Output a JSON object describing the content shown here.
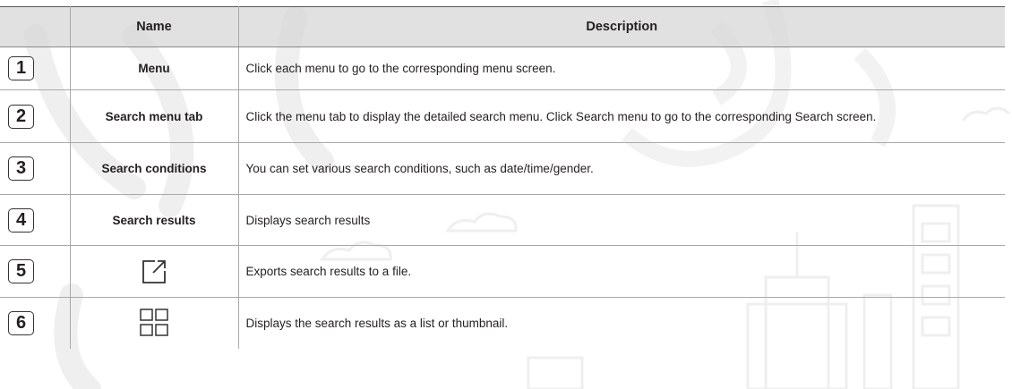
{
  "header": {
    "name_col": "Name",
    "desc_col": "Description"
  },
  "rows": [
    {
      "num": "1",
      "name": "Menu",
      "description": "Click each menu to go to the corresponding menu screen."
    },
    {
      "num": "2",
      "name": "Search menu tab",
      "description": "Click the menu tab to display the detailed search menu. Click Search menu to go to the corresponding Search screen."
    },
    {
      "num": "3",
      "name": "Search conditions",
      "description": "You can set various search conditions, such as date/time/gender."
    },
    {
      "num": "4",
      "name": "Search results",
      "description": "Displays search results"
    },
    {
      "num": "5",
      "name": "",
      "icon": "export-icon",
      "description": "Exports search results to a file."
    },
    {
      "num": "6",
      "name": "",
      "icon": "grid-view-icon",
      "description": "Displays the search results as a list or thumbnail."
    }
  ],
  "colors": {
    "header_bg": "#d6d6d6",
    "watermark": "#f0f0f0",
    "text": "#231f20"
  }
}
